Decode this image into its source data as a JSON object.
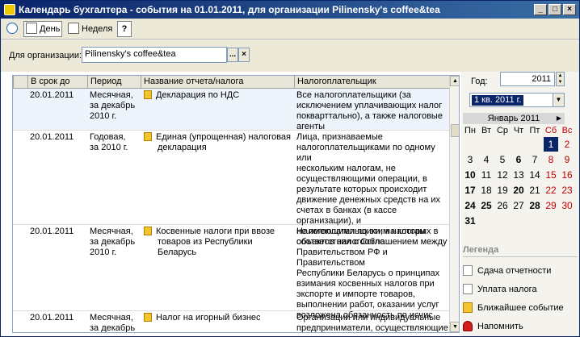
{
  "window": {
    "title": "Календарь бухгалтера - события на 01.01.2011, для организации Pilinensky's coffee&tea"
  },
  "toolbar": {
    "day": "День",
    "week": "Неделя",
    "help": "?"
  },
  "org": {
    "label": "Для организации:",
    "value": "Pilinensky's coffee&tea",
    "select": "...",
    "clear": "×"
  },
  "grid": {
    "headers": [
      "В срок до",
      "Период",
      "Название отчета/налога",
      "Налогоплательщик"
    ],
    "rows": [
      {
        "date": "20.01.2011",
        "period": [
          "Месячная,",
          "за декабрь",
          "2010 г."
        ],
        "name": [
          "Декларация по НДС"
        ],
        "payer": [
          "Все налогоплательщики (за",
          "исключением уплачивающих налог",
          "покварттально), а также налоговые",
          "агенты"
        ]
      },
      {
        "date": "20.01.2011",
        "period": [
          "Годовая,",
          "за 2010 г."
        ],
        "name": [
          "Единая (упрощенная) налоговая",
          "декларация"
        ],
        "payer": [
          "Лица, признаваемые",
          "налогоплательщиками по одному или",
          "нескольким налогам, не",
          "осуществляющими операции, в",
          "результате которых происходит",
          "движение денежных средств на их",
          "счетах в банках (в кассе организации), и",
          "не имеющими по этим налогам",
          "объектов налогообло"
        ]
      },
      {
        "date": "20.01.2011",
        "period": [
          "Месячная,",
          "за декабрь",
          "2010 г."
        ],
        "name": [
          "Косвенные налоги при ввозе",
          "товаров из Республики Беларусь"
        ],
        "payer": [
          "Налогоплательщики, на которых в",
          "соответствии с Соглашением между",
          "Правительством РФ и Правительством",
          "Республики Беларусь о принципах",
          "взимания косвенных налогов при",
          "экспорте и импорте товаров,",
          "выполнении работ, оказании услуг",
          "возложена обязанность по исчис"
        ]
      },
      {
        "date": "20.01.2011",
        "period": [
          "Месячная,",
          "за декабрь"
        ],
        "name": [
          "Налог на игорный бизнес"
        ],
        "payer": [
          "Организации или индивидуальные",
          "предприниматели, осуществляющие"
        ]
      }
    ]
  },
  "year": {
    "label": "Год:",
    "value": "2011"
  },
  "quarter": {
    "value": "1 кв. 2011 г."
  },
  "calendar": {
    "month": "Январь 2011",
    "dows": [
      "Пн",
      "Вт",
      "Ср",
      "Чт",
      "Пт",
      "Сб",
      "Вс"
    ],
    "weeks": [
      [
        "",
        "",
        "",
        "",
        "",
        "1",
        "2"
      ],
      [
        "3",
        "4",
        "5",
        "6",
        "7",
        "8",
        "9"
      ],
      [
        "10",
        "11",
        "12",
        "13",
        "14",
        "15",
        "16"
      ],
      [
        "17",
        "18",
        "19",
        "20",
        "21",
        "22",
        "23"
      ],
      [
        "24",
        "25",
        "26",
        "27",
        "28",
        "29",
        "30"
      ],
      [
        "31",
        "",
        "",
        "",
        "",
        "",
        ""
      ]
    ],
    "bold_days": [
      "6",
      "10",
      "17",
      "20",
      "24",
      "25",
      "28",
      "31"
    ],
    "selected_day": "1"
  },
  "legend": {
    "title": "Легенда",
    "items": [
      {
        "icon": "report-icon",
        "label": "Сдача отчетности"
      },
      {
        "icon": "tax-payment-icon",
        "label": "Уплата налога"
      },
      {
        "icon": "nearest-event-icon",
        "label": "Ближайшее событие"
      },
      {
        "icon": "bell-icon",
        "label": "Напомнить"
      }
    ]
  },
  "colors": {
    "titlebar": "#0a246a",
    "selection": "#0a246a",
    "weekend": "#c00000",
    "event_icon": "#f4c430"
  }
}
